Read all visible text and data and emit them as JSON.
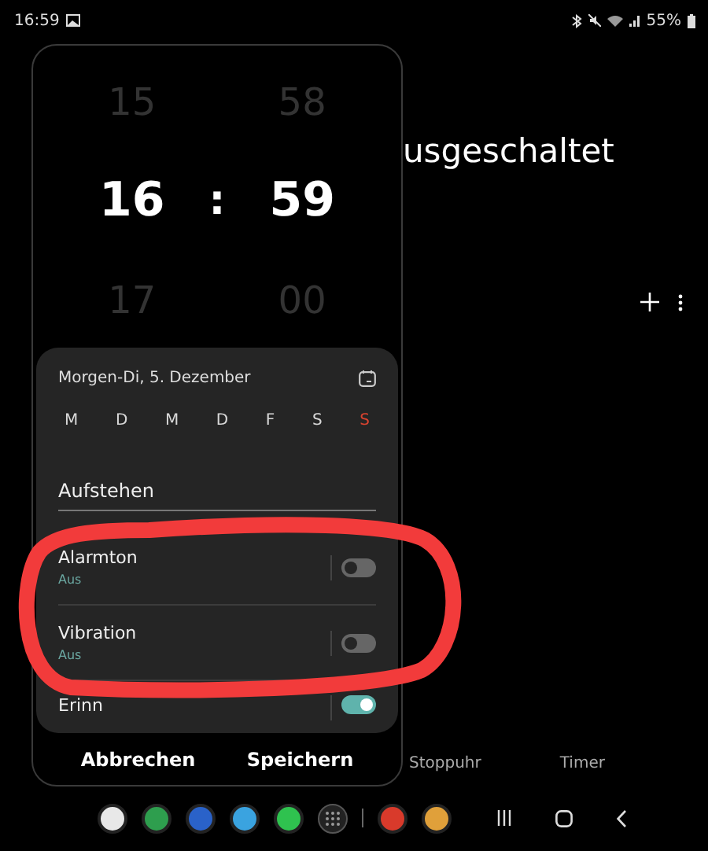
{
  "status_bar": {
    "time": "16:59",
    "battery": "55%"
  },
  "background": {
    "title": "usgeschaltet",
    "tabs": [
      {
        "label": "Stoppuhr"
      },
      {
        "label": "Timer"
      }
    ]
  },
  "alarm_dialog": {
    "hours": [
      {
        "value": "15",
        "selected": false
      },
      {
        "value": "16",
        "selected": true
      },
      {
        "value": "17",
        "selected": false
      }
    ],
    "separator": ":",
    "minutes": [
      {
        "value": "58",
        "selected": false
      },
      {
        "value": "59",
        "selected": true
      },
      {
        "value": "00",
        "selected": false
      }
    ],
    "date": "Morgen-Di, 5. Dezember",
    "days": [
      {
        "label": "M",
        "color": "#d8d8d8"
      },
      {
        "label": "D",
        "color": "#d8d8d8"
      },
      {
        "label": "M",
        "color": "#d8d8d8"
      },
      {
        "label": "D",
        "color": "#d8d8d8"
      },
      {
        "label": "F",
        "color": "#d8d8d8"
      },
      {
        "label": "S",
        "color": "#d8d8d8"
      },
      {
        "label": "S",
        "color": "#d9432f"
      }
    ],
    "alarm_name": "Aufstehen",
    "settings": [
      {
        "label": "Alarmton",
        "value": "Aus",
        "on": false
      },
      {
        "label": "Vibration",
        "value": "Aus",
        "on": false
      },
      {
        "label": "Erinn",
        "on": true
      }
    ],
    "buttons": [
      "Abbrechen",
      "Speichern"
    ]
  }
}
